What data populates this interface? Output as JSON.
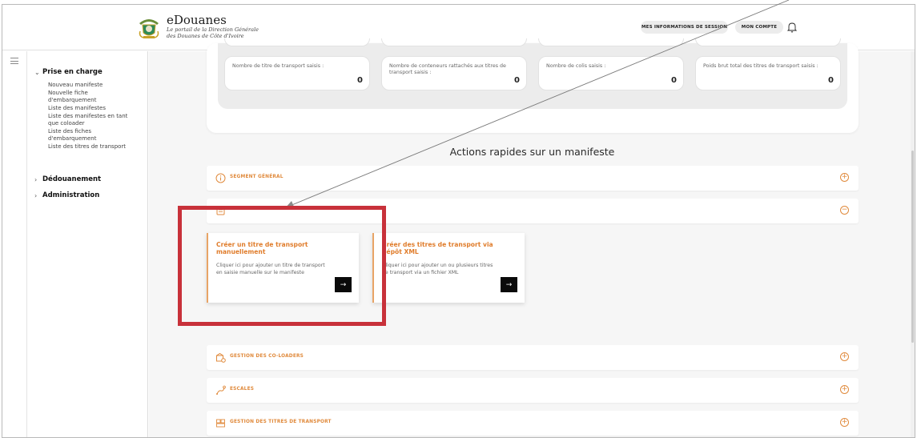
{
  "header": {
    "brand_title": "eDouanes",
    "brand_subtitle_1": "Le portail de la Direction Générale",
    "brand_subtitle_2": "des Douanes de Côte d'Ivoire",
    "session_button": "MES INFORMATIONS DE SESSION",
    "account_button": "MON COMPTE"
  },
  "sidebar": {
    "groups": [
      {
        "label": "Prise en charge",
        "expanded": true
      },
      {
        "label": "Dédouanement",
        "expanded": false
      },
      {
        "label": "Administration",
        "expanded": false
      }
    ],
    "items": [
      "Nouveau manifeste",
      "Nouvelle fiche d'embarquement",
      "Liste des manifestes",
      "Liste des manifestes en tant que coloader",
      "Liste des fiches d'embarquement",
      "Liste des titres de transport"
    ]
  },
  "stats": [
    {
      "label": "Nombre de titre de transport saisis :",
      "value": "0"
    },
    {
      "label": "Nombre de conteneurs rattachés aux titres de transport saisis :",
      "value": "0"
    },
    {
      "label": "Nombre de colis saisis :",
      "value": "0"
    },
    {
      "label": "Poids brut total des titres de transport saisis :",
      "value": "0"
    }
  ],
  "main": {
    "section_title": "Actions rapides sur un manifeste",
    "accordions": [
      {
        "label": "SEGMENT GÉNÉRAL",
        "icon": "info-icon",
        "toggle": "+"
      },
      {
        "label": "",
        "icon": "document-icon",
        "toggle": "−"
      },
      {
        "label": "GESTION DES CO-LOADERS",
        "icon": "box-gear-icon",
        "toggle": "+"
      },
      {
        "label": "ESCALES",
        "icon": "route-icon",
        "toggle": "+"
      },
      {
        "label": "GESTION DES TITRES DE TRANSPORT",
        "icon": "cargo-icon",
        "toggle": "+"
      }
    ],
    "actions": [
      {
        "title": "Créer un titre de transport manuellement",
        "description": "Cliquer ici pour ajouter un titre de transport en saisie manuelle sur le manifeste",
        "button": "→"
      },
      {
        "title": "Créer des titres de transport via dépôt XML",
        "description": "Cliquer ici pour ajouter un ou plusieurs titres de transport via un fichier XML",
        "button": "→"
      }
    ]
  },
  "colors": {
    "accent": "#e08a3c",
    "highlight": "#c8313a",
    "button": "#0a0a0a"
  }
}
